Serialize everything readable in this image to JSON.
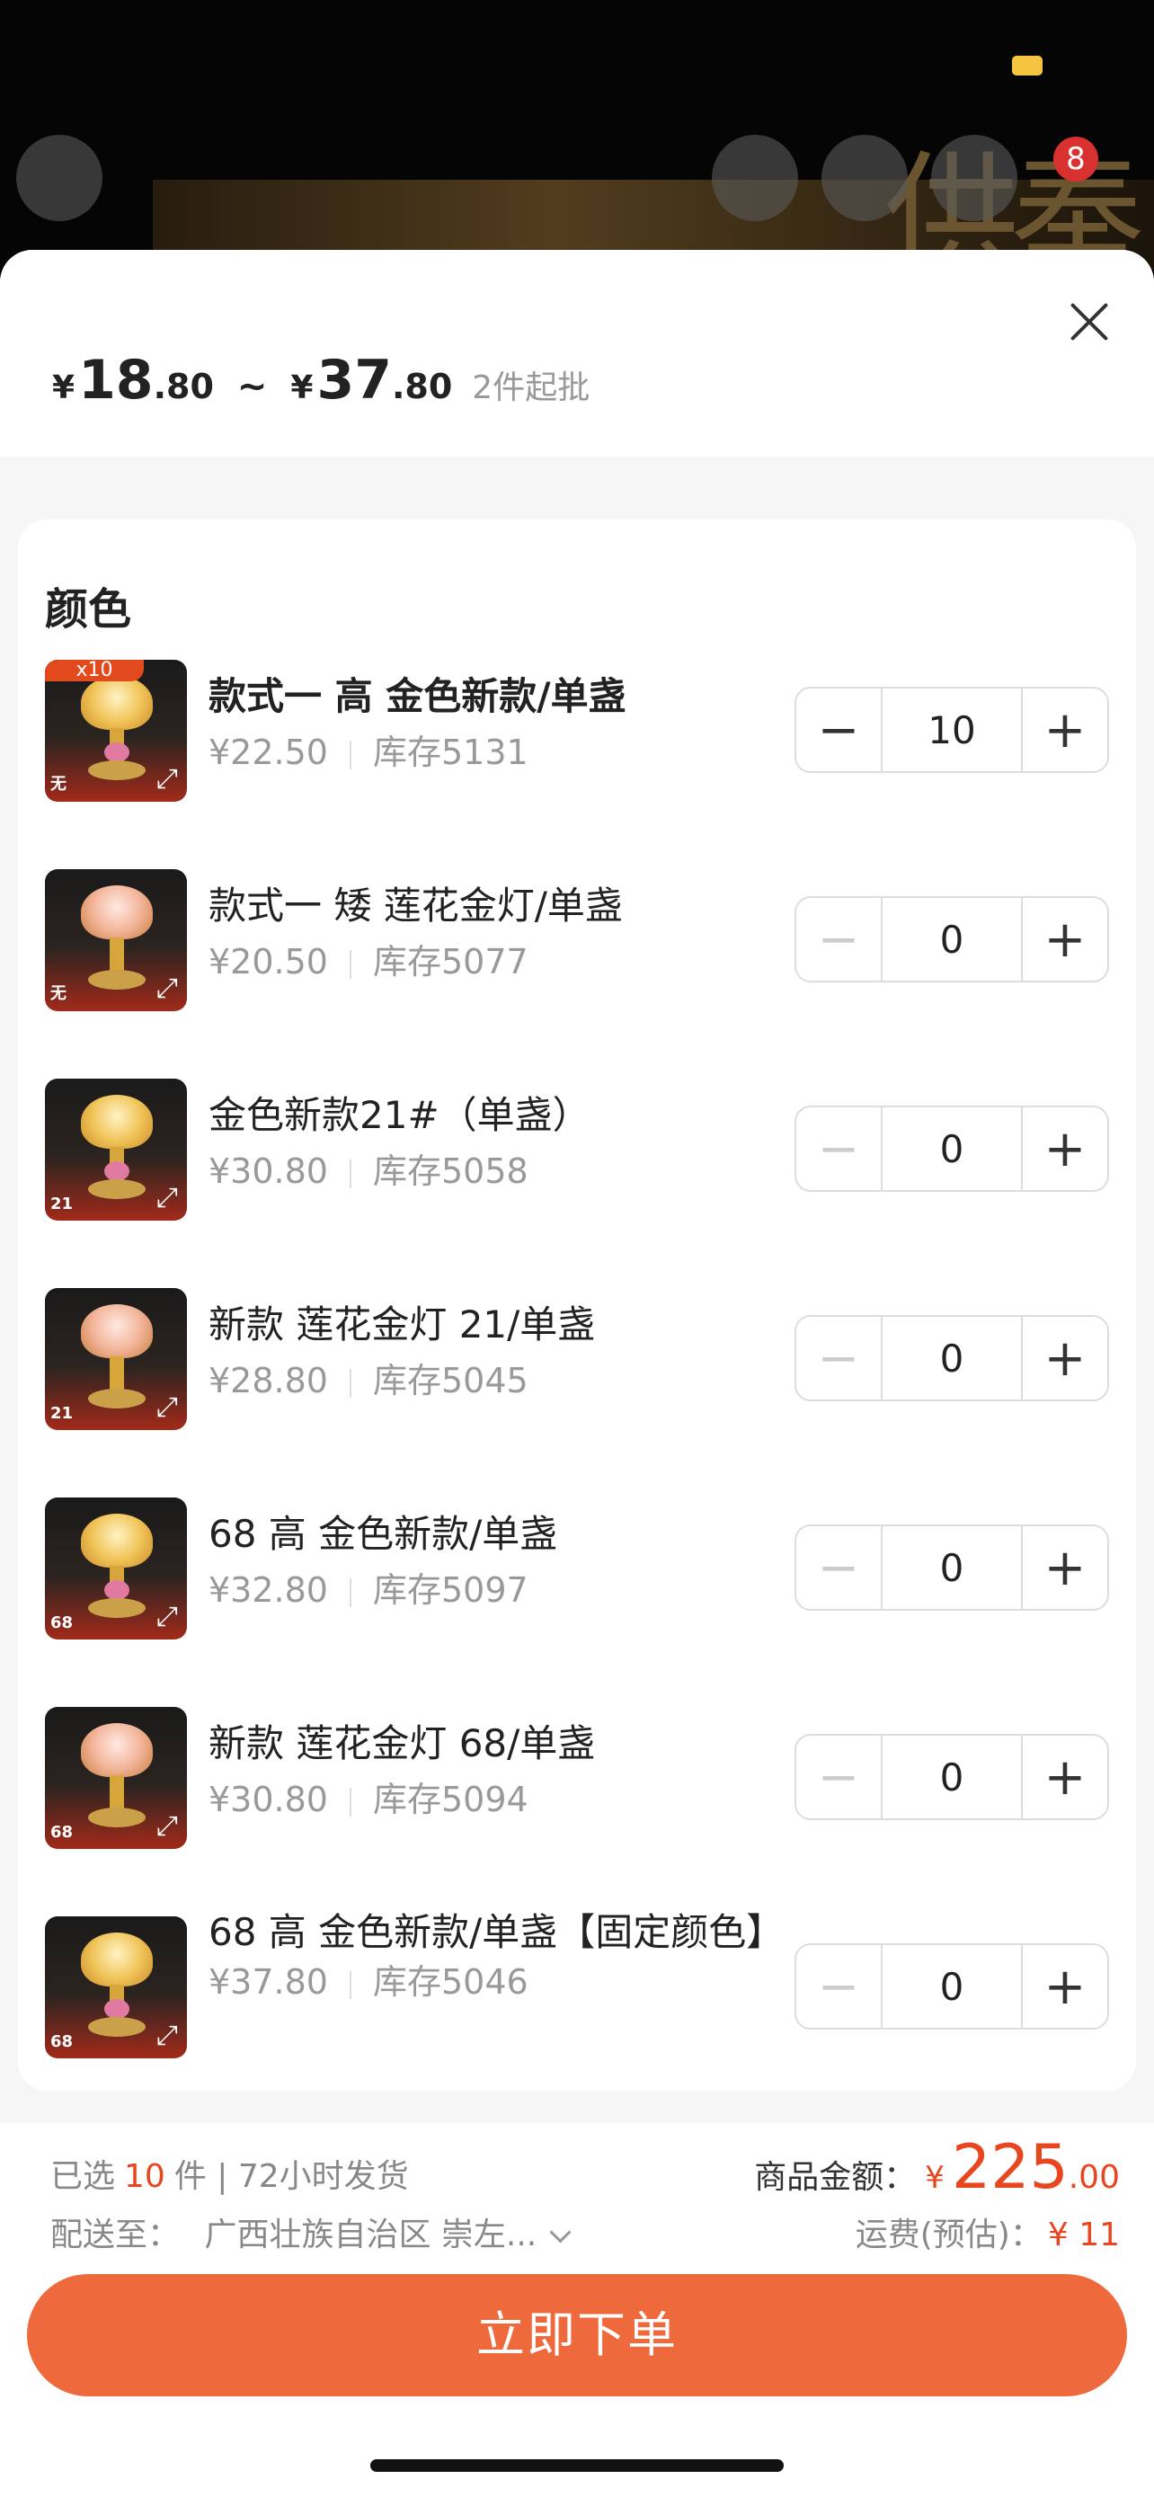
{
  "background": {
    "banner_text": "供奉",
    "cart_badge": "8"
  },
  "sheet": {
    "price": {
      "min_currency": "¥",
      "min_int": "18",
      "min_dec": ".80",
      "separator": "~",
      "max_currency": "¥",
      "max_int": "37",
      "max_dec": ".80",
      "min_order": "2件起批"
    },
    "section_title": "颜色",
    "variants": [
      {
        "name": "款式一 高 金色新款/单盏",
        "price": "¥22.50",
        "stock": "库存5131",
        "qty": "10",
        "tag": "无",
        "ribbon": "x10",
        "style": "gold"
      },
      {
        "name": "款式一 矮 莲花金灯/单盏",
        "price": "¥20.50",
        "stock": "库存5077",
        "qty": "0",
        "tag": "无",
        "style": "pink"
      },
      {
        "name": "金色新款21#（单盏）",
        "price": "¥30.80",
        "stock": "库存5058",
        "qty": "0",
        "tag": "21",
        "style": "gold"
      },
      {
        "name": "新款 莲花金灯 21/单盏",
        "price": "¥28.80",
        "stock": "库存5045",
        "qty": "0",
        "tag": "21",
        "style": "pink"
      },
      {
        "name": "68 高 金色新款/单盏",
        "price": "¥32.80",
        "stock": "库存5097",
        "qty": "0",
        "tag": "68",
        "style": "gold"
      },
      {
        "name": "新款 莲花金灯 68/单盏",
        "price": "¥30.80",
        "stock": "库存5094",
        "qty": "0",
        "tag": "68",
        "style": "pink"
      },
      {
        "name": "68 高 金色新款/单盏【固定颜色】",
        "price": "¥37.80",
        "stock": "库存5046",
        "qty": "0",
        "tag": "68",
        "style": "gold"
      }
    ]
  },
  "footer": {
    "selected_prefix": "已选",
    "selected_count": "10",
    "selected_suffix": "件 | 72小时发货",
    "deliver_label": "配送至：",
    "deliver_address": "广西壮族自治区 崇左...",
    "amount_label": "商品金额：",
    "amount_currency": "¥",
    "amount_int": "225",
    "amount_dec": ".00",
    "shipping_label": "运费(预估)：",
    "shipping_value": "¥ 11",
    "order_button": "立即下单"
  },
  "colors": {
    "accent": "#ee6a3c",
    "price_red": "#e8461f"
  }
}
